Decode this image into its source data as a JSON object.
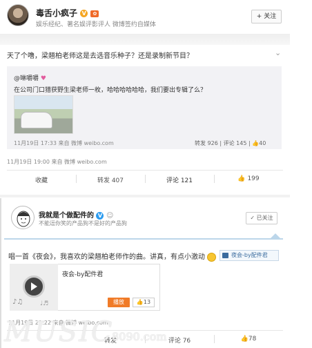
{
  "post1": {
    "author": "毒舌小疯子",
    "author_desc": "娱乐经纪、著名娱评影评人 微博签约自媒体",
    "follow_label": "+ 关注",
    "text": "天了个噜，梁翘柏老师这是去选音乐种子？还是录制新节目？",
    "quote": {
      "author": "@琳嚼嚼",
      "text": "在公司门口猎获野生梁老师一枚，哈哈哈哈哈哈，我们要出专辑了么？",
      "time": "11月19日 17:33 来自 微博 weibo.com",
      "stats": "转发 926 | 评论 145 | 👍40"
    },
    "time": "11月19日 19:00 来自 微博 weibo.com",
    "actions": {
      "favorite": "收藏",
      "repost": "转发 407",
      "comment": "评论 121",
      "like": "👍 199"
    }
  },
  "post2": {
    "author": "我就是个做配件的",
    "author_desc": "不能逗你笑的产品狗不是好的产品狗",
    "followed_label": "✓ 已关注",
    "text": "唱一首《夜会》，我喜欢的梁翘柏老师作的曲。讲真，有点小激动",
    "music_link": "夜会-by配件君",
    "song_title": "夜会-by配件君",
    "play_label": "播放",
    "like_count": "👍13",
    "time": "11月19日 21:22 来自 微博 weibo.com",
    "actions": {
      "repost": "转发",
      "comment": "评论 76",
      "like": "👍78"
    }
  },
  "watermark": {
    "big": "MUSIC",
    "small": "8090.com"
  }
}
